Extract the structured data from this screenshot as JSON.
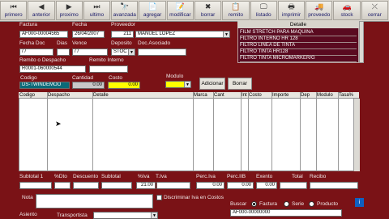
{
  "toolbar": {
    "buttons": [
      {
        "label": "primero",
        "icon": "⏮"
      },
      {
        "label": "anterior",
        "icon": "◀"
      },
      {
        "label": "proximo",
        "icon": "▶"
      },
      {
        "label": "ultimo",
        "icon": "⏭"
      },
      {
        "label": "avanzada",
        "icon": "🔭"
      },
      {
        "label": "agregar",
        "icon": "📄"
      },
      {
        "label": "modificar",
        "icon": "📝"
      },
      {
        "label": "borrar",
        "icon": "✖"
      },
      {
        "label": "remito",
        "icon": "📋"
      },
      {
        "label": "listado",
        "icon": "🖵"
      },
      {
        "label": "imprimir",
        "icon": "🖶"
      },
      {
        "label": "proveedo",
        "icon": "🚚"
      },
      {
        "label": "stock",
        "icon": "🚗"
      },
      {
        "label": "cerrar",
        "icon": "⤫"
      }
    ]
  },
  "header": {
    "factura_label": "Factura",
    "factura_value": "AF000-00004565",
    "fecha_label": "Fecha",
    "fecha_value": "26/04/2007",
    "proveedor_label": "Proveedor",
    "proveedor_code": "211",
    "proveedor_name": "MANUEL LOPEZ",
    "fecha_doc_label": "Fecha Doc",
    "fecha_doc_value": "/ /",
    "dias_label": "Dias",
    "dias_value": "",
    "vence_label": "Vence",
    "vence_value": "/ /",
    "deposito_label": "Deposito",
    "deposito_value": "STOC",
    "doc_asociado_label": "Doc.Asociado",
    "doc_asociado_value": "",
    "remito_label": "Remito o Despacho",
    "remito_value": "R0001-060000544",
    "remito_interno_label": "Remito Interno",
    "remito_interno_value": "",
    "codigo_label": "Codigo",
    "codigo_value": "DS-TWINDEMOO",
    "cantidad_label": "Cantidad",
    "cantidad_value": "0.00",
    "costo_label": "Costo",
    "costo_value": "0.00",
    "modulo_label": "Modulo",
    "modulo_value": "",
    "adicionar_label": "Adicionar",
    "borrar_label": "Borrar"
  },
  "detalle": {
    "title": "Detalle",
    "items": [
      "FILM STRETCH PARA MAQUINA",
      "FILTRO INTERNO HR 128",
      "FILTRO LINEA DE TINTA",
      "FILTRO TINTA HR128",
      "FILTRO TINTA MICROMARKER/G"
    ]
  },
  "grid": {
    "columns": [
      "Codigo",
      "Despacho",
      "Detalle",
      "Marca",
      "Cant",
      "Int",
      "Costo",
      "Importe",
      "Dep",
      "Modulo",
      "Tasa%"
    ]
  },
  "totals": {
    "labels": [
      "Subtotal 1",
      "%Dto",
      "Descuento",
      "Subtotal",
      "%Iva",
      "T.Iva",
      "Perc.Iva",
      "Perc.IIB",
      "Exento",
      "Total",
      "Recibo"
    ],
    "subtotal1": "",
    "dto": "",
    "descuento": "",
    "subtotal": "",
    "iva_pct": "21.00",
    "t_iva": "",
    "perc_iva": "0.00",
    "perc_iib": "0.00",
    "exento": "0.00",
    "total": "",
    "recibo": ""
  },
  "footer": {
    "nota_label": "Nota",
    "nota_value": "",
    "discriminar_label": "Discriminar Iva en Costos",
    "buscar_label": "Buscar",
    "radio_factura": "Factura",
    "radio_serie": "Serie",
    "radio_producto": "Producto",
    "search_value": "AF000-00000000",
    "asiento_label": "Asiento",
    "transportista_label": "Transportista"
  }
}
